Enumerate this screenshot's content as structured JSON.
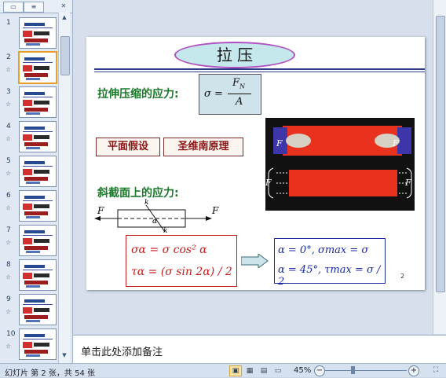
{
  "thumbnails": {
    "tabs": [
      "",
      ""
    ],
    "slides": [
      {
        "num": "1",
        "star": ""
      },
      {
        "num": "2",
        "star": "☆"
      },
      {
        "num": "3",
        "star": "☆"
      },
      {
        "num": "4",
        "star": "☆"
      },
      {
        "num": "5",
        "star": "☆"
      },
      {
        "num": "6",
        "star": "☆"
      },
      {
        "num": "7",
        "star": "☆"
      },
      {
        "num": "8",
        "star": "☆"
      },
      {
        "num": "9",
        "star": "☆"
      },
      {
        "num": "10",
        "star": "☆"
      }
    ],
    "active_index": 1
  },
  "slide": {
    "title": "拉 压",
    "stress_label": "拉伸压缩的应力:",
    "formula_sigma": "σ =",
    "formula_num": "F",
    "formula_num_sub": "N",
    "formula_den": "A",
    "tag1": "平面假设",
    "tag2": "圣维南原理",
    "oblique_label": "斜截面上的应力:",
    "photo_f1": "F",
    "photo_f2": "F",
    "photo_f3": "F",
    "photo_f4": "F",
    "diag_f_left": "F",
    "diag_f_right": "F",
    "diag_k_top": "k",
    "diag_k_bottom": "k",
    "diag_alpha": "α",
    "red_line1": "σα = σ cos² α",
    "red_line2": "τα = (σ sin 2α) / 2",
    "blue_line1": "α = 0°, σmax = σ",
    "blue_line2": "α = 45°, τmax = σ / 2",
    "page_number": "2"
  },
  "notes": {
    "placeholder": "单击此处添加备注"
  },
  "status": {
    "slide_info": "幻灯片 第 2 张，共 54 张",
    "zoom": "45%",
    "zoom_minus": "−",
    "zoom_plus": "+"
  }
}
